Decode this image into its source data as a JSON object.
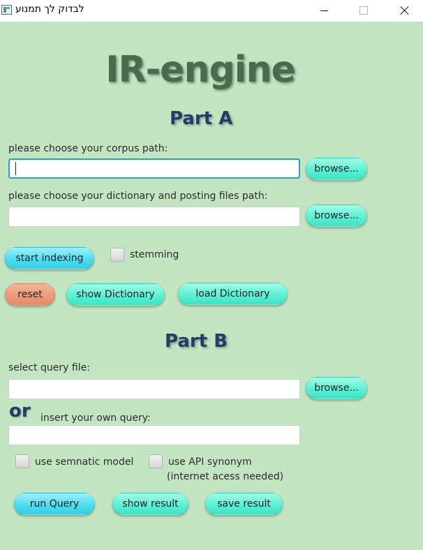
{
  "window": {
    "title": "לבדוק לך תמנוע",
    "minimize_icon": "minimize-icon",
    "maximize_icon": "maximize-icon",
    "close_icon": "close-icon"
  },
  "app_title": "IR-engine",
  "part_a": {
    "title": "Part A",
    "corpus_label": "please choose your corpus path:",
    "corpus_value": "",
    "corpus_browse": "browse...",
    "dict_label": "please choose your dictionary and posting files path:",
    "dict_value": "",
    "dict_browse": "browse...",
    "start_indexing": "start indexing",
    "stemming_label": "stemming",
    "stemming_checked": false,
    "reset": "reset",
    "show_dictionary": "show Dictionary",
    "load_dictionary": "load Dictionary"
  },
  "part_b": {
    "title": "Part B",
    "query_file_label": "select query file:",
    "query_file_value": "",
    "query_browse": "browse...",
    "or_label": "or",
    "own_query_label": "insert your own query:",
    "own_query_value": "",
    "semantic_label": "use semnatic model",
    "semantic_checked": false,
    "api_label": "use API synonym",
    "api_note": "(internet acess needed)",
    "api_checked": false,
    "run_query": "run Query",
    "show_result": "show result",
    "save_result": "save result"
  },
  "colors": {
    "background": "#c3e5c2",
    "title_green": "#4a6b4d",
    "part_navy": "#283a66",
    "mint_button": "#5ef0d4",
    "cyan_button": "#4fdcef",
    "salmon_button": "#ec9878",
    "focus_border": "#2f9fbf"
  }
}
